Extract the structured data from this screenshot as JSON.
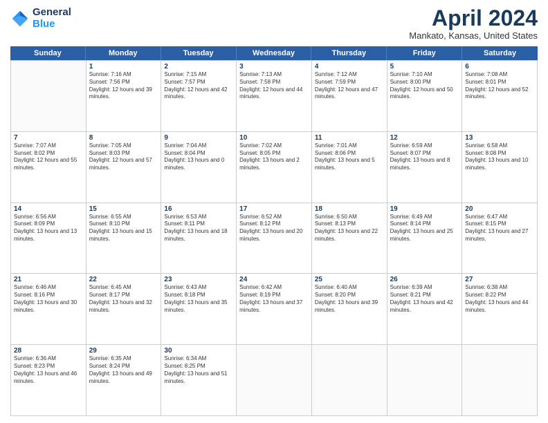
{
  "header": {
    "logo_line1": "General",
    "logo_line2": "Blue",
    "month_title": "April 2024",
    "location": "Mankato, Kansas, United States"
  },
  "days": [
    "Sunday",
    "Monday",
    "Tuesday",
    "Wednesday",
    "Thursday",
    "Friday",
    "Saturday"
  ],
  "weeks": [
    [
      {
        "date": "",
        "sunrise": "",
        "sunset": "",
        "daylight": ""
      },
      {
        "date": "1",
        "sunrise": "Sunrise: 7:16 AM",
        "sunset": "Sunset: 7:56 PM",
        "daylight": "Daylight: 12 hours and 39 minutes."
      },
      {
        "date": "2",
        "sunrise": "Sunrise: 7:15 AM",
        "sunset": "Sunset: 7:57 PM",
        "daylight": "Daylight: 12 hours and 42 minutes."
      },
      {
        "date": "3",
        "sunrise": "Sunrise: 7:13 AM",
        "sunset": "Sunset: 7:58 PM",
        "daylight": "Daylight: 12 hours and 44 minutes."
      },
      {
        "date": "4",
        "sunrise": "Sunrise: 7:12 AM",
        "sunset": "Sunset: 7:59 PM",
        "daylight": "Daylight: 12 hours and 47 minutes."
      },
      {
        "date": "5",
        "sunrise": "Sunrise: 7:10 AM",
        "sunset": "Sunset: 8:00 PM",
        "daylight": "Daylight: 12 hours and 50 minutes."
      },
      {
        "date": "6",
        "sunrise": "Sunrise: 7:08 AM",
        "sunset": "Sunset: 8:01 PM",
        "daylight": "Daylight: 12 hours and 52 minutes."
      }
    ],
    [
      {
        "date": "7",
        "sunrise": "Sunrise: 7:07 AM",
        "sunset": "Sunset: 8:02 PM",
        "daylight": "Daylight: 12 hours and 55 minutes."
      },
      {
        "date": "8",
        "sunrise": "Sunrise: 7:05 AM",
        "sunset": "Sunset: 8:03 PM",
        "daylight": "Daylight: 12 hours and 57 minutes."
      },
      {
        "date": "9",
        "sunrise": "Sunrise: 7:04 AM",
        "sunset": "Sunset: 8:04 PM",
        "daylight": "Daylight: 13 hours and 0 minutes."
      },
      {
        "date": "10",
        "sunrise": "Sunrise: 7:02 AM",
        "sunset": "Sunset: 8:05 PM",
        "daylight": "Daylight: 13 hours and 2 minutes."
      },
      {
        "date": "11",
        "sunrise": "Sunrise: 7:01 AM",
        "sunset": "Sunset: 8:06 PM",
        "daylight": "Daylight: 13 hours and 5 minutes."
      },
      {
        "date": "12",
        "sunrise": "Sunrise: 6:59 AM",
        "sunset": "Sunset: 8:07 PM",
        "daylight": "Daylight: 13 hours and 8 minutes."
      },
      {
        "date": "13",
        "sunrise": "Sunrise: 6:58 AM",
        "sunset": "Sunset: 8:08 PM",
        "daylight": "Daylight: 13 hours and 10 minutes."
      }
    ],
    [
      {
        "date": "14",
        "sunrise": "Sunrise: 6:56 AM",
        "sunset": "Sunset: 8:09 PM",
        "daylight": "Daylight: 13 hours and 13 minutes."
      },
      {
        "date": "15",
        "sunrise": "Sunrise: 6:55 AM",
        "sunset": "Sunset: 8:10 PM",
        "daylight": "Daylight: 13 hours and 15 minutes."
      },
      {
        "date": "16",
        "sunrise": "Sunrise: 6:53 AM",
        "sunset": "Sunset: 8:11 PM",
        "daylight": "Daylight: 13 hours and 18 minutes."
      },
      {
        "date": "17",
        "sunrise": "Sunrise: 6:52 AM",
        "sunset": "Sunset: 8:12 PM",
        "daylight": "Daylight: 13 hours and 20 minutes."
      },
      {
        "date": "18",
        "sunrise": "Sunrise: 6:50 AM",
        "sunset": "Sunset: 8:13 PM",
        "daylight": "Daylight: 13 hours and 22 minutes."
      },
      {
        "date": "19",
        "sunrise": "Sunrise: 6:49 AM",
        "sunset": "Sunset: 8:14 PM",
        "daylight": "Daylight: 13 hours and 25 minutes."
      },
      {
        "date": "20",
        "sunrise": "Sunrise: 6:47 AM",
        "sunset": "Sunset: 8:15 PM",
        "daylight": "Daylight: 13 hours and 27 minutes."
      }
    ],
    [
      {
        "date": "21",
        "sunrise": "Sunrise: 6:46 AM",
        "sunset": "Sunset: 8:16 PM",
        "daylight": "Daylight: 13 hours and 30 minutes."
      },
      {
        "date": "22",
        "sunrise": "Sunrise: 6:45 AM",
        "sunset": "Sunset: 8:17 PM",
        "daylight": "Daylight: 13 hours and 32 minutes."
      },
      {
        "date": "23",
        "sunrise": "Sunrise: 6:43 AM",
        "sunset": "Sunset: 8:18 PM",
        "daylight": "Daylight: 13 hours and 35 minutes."
      },
      {
        "date": "24",
        "sunrise": "Sunrise: 6:42 AM",
        "sunset": "Sunset: 8:19 PM",
        "daylight": "Daylight: 13 hours and 37 minutes."
      },
      {
        "date": "25",
        "sunrise": "Sunrise: 6:40 AM",
        "sunset": "Sunset: 8:20 PM",
        "daylight": "Daylight: 13 hours and 39 minutes."
      },
      {
        "date": "26",
        "sunrise": "Sunrise: 6:39 AM",
        "sunset": "Sunset: 8:21 PM",
        "daylight": "Daylight: 13 hours and 42 minutes."
      },
      {
        "date": "27",
        "sunrise": "Sunrise: 6:38 AM",
        "sunset": "Sunset: 8:22 PM",
        "daylight": "Daylight: 13 hours and 44 minutes."
      }
    ],
    [
      {
        "date": "28",
        "sunrise": "Sunrise: 6:36 AM",
        "sunset": "Sunset: 8:23 PM",
        "daylight": "Daylight: 13 hours and 46 minutes."
      },
      {
        "date": "29",
        "sunrise": "Sunrise: 6:35 AM",
        "sunset": "Sunset: 8:24 PM",
        "daylight": "Daylight: 13 hours and 49 minutes."
      },
      {
        "date": "30",
        "sunrise": "Sunrise: 6:34 AM",
        "sunset": "Sunset: 8:25 PM",
        "daylight": "Daylight: 13 hours and 51 minutes."
      },
      {
        "date": "",
        "sunrise": "",
        "sunset": "",
        "daylight": ""
      },
      {
        "date": "",
        "sunrise": "",
        "sunset": "",
        "daylight": ""
      },
      {
        "date": "",
        "sunrise": "",
        "sunset": "",
        "daylight": ""
      },
      {
        "date": "",
        "sunrise": "",
        "sunset": "",
        "daylight": ""
      }
    ]
  ]
}
